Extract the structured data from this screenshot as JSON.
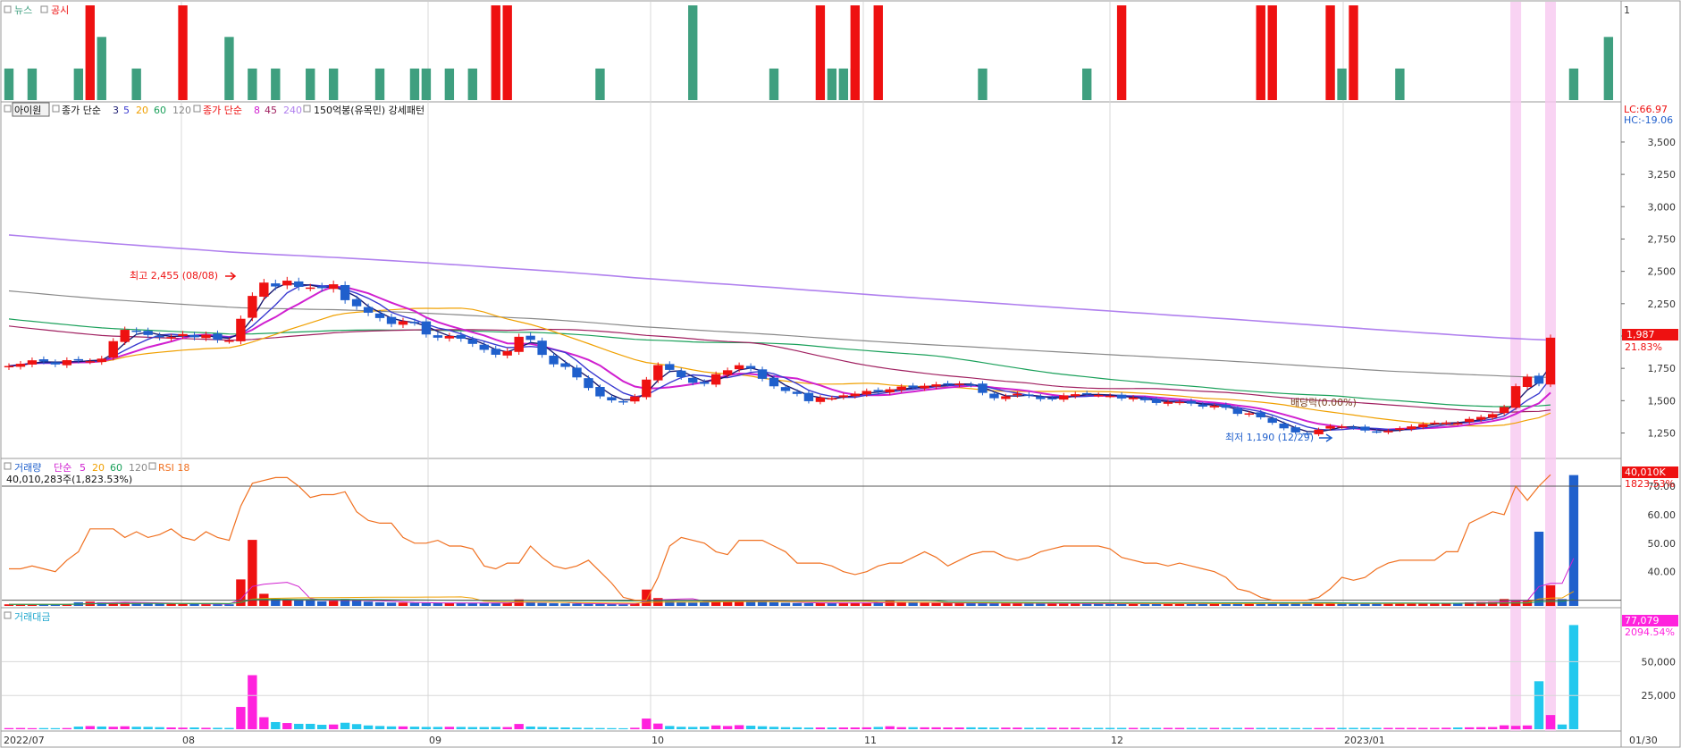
{
  "colors": {
    "up": "#ee1111",
    "down": "#1f5fcc",
    "news": "#3f9f7f",
    "disclosure": "#ee1111",
    "ma3": "#1a1a70",
    "ma5": "#3a3ad0",
    "ma20": "#f0a000",
    "ma60": "#1aa05a",
    "ma120": "#888888",
    "ma8": "#d020d0",
    "ma45": "#a02060",
    "ma240": "#b080ee",
    "rsi": "#f07020",
    "volume_up": "#ee1111",
    "volume_down": "#2060cc",
    "amount_up": "#ff22dd",
    "amount_down": "#22c8ee",
    "highlight": "#f8c8f0",
    "grid": "#d8d8d8"
  },
  "panels": {
    "news": {
      "news_label": "뉴스",
      "disclosure_label": "공시",
      "axis_value": "1"
    },
    "price": {
      "stock_name": "아이원",
      "ma_group_1": {
        "label": "종가 단순",
        "periods": [
          "3",
          "5",
          "20",
          "60",
          "120"
        ]
      },
      "ma_group_2": {
        "label": "종가 단순",
        "periods": [
          "8",
          "45",
          "240"
        ]
      },
      "pattern_label": "150억봉(유목민) 강세패턴",
      "lc": "LC:66.97",
      "hc": "HC:-19.06",
      "last_price": "1,987",
      "last_change": "21.83%",
      "high_label": "최고 2,455 (08/08)",
      "low_label": "최저 1,190 (12/29)",
      "dividend_label": "배당락(0.00%)"
    },
    "volume": {
      "title": "거래량",
      "ma_label": "단순",
      "ma_periods": [
        "5",
        "20",
        "60",
        "120"
      ],
      "rsi_label": "RSI 18",
      "info": "40,010,283주(1,823.53%)",
      "last_value": "40,010K",
      "last_pct": "1823.53%"
    },
    "amount": {
      "title": "거래대금",
      "last_value": "77,079",
      "last_pct": "2094.54%"
    }
  },
  "x_axis_labels": [
    "2022/07",
    "08",
    "09",
    "10",
    "11",
    "12",
    "2023/01",
    "01/30"
  ],
  "chart_data": [
    {
      "type": "bar",
      "title": "뉴스 / 공시",
      "series": [
        {
          "name": "뉴스",
          "bars": [
            [
              0,
              1
            ],
            [
              2,
              1
            ],
            [
              6,
              1
            ],
            [
              8,
              2
            ],
            [
              11,
              1
            ],
            [
              19,
              2
            ],
            [
              21,
              1
            ],
            [
              23,
              1
            ],
            [
              26,
              1
            ],
            [
              28,
              1
            ],
            [
              32,
              1
            ],
            [
              35,
              1
            ],
            [
              36,
              1
            ],
            [
              38,
              1
            ],
            [
              40,
              1
            ],
            [
              51,
              1
            ],
            [
              59,
              3
            ],
            [
              66,
              1
            ],
            [
              71,
              1
            ],
            [
              72,
              1
            ],
            [
              73,
              1
            ],
            [
              84,
              1
            ],
            [
              93,
              1
            ],
            [
              115,
              1
            ],
            [
              120,
              1
            ],
            [
              135,
              1
            ],
            [
              138,
              2
            ]
          ]
        },
        {
          "name": "공시",
          "bars": [
            [
              7,
              3
            ],
            [
              15,
              3
            ],
            [
              42,
              3
            ],
            [
              43,
              3
            ],
            [
              70,
              3
            ],
            [
              73,
              3
            ],
            [
              75,
              3
            ],
            [
              96,
              3
            ],
            [
              108,
              3
            ],
            [
              109,
              3
            ],
            [
              114,
              3
            ],
            [
              116,
              3
            ]
          ]
        }
      ],
      "ylim": [
        0,
        3
      ]
    },
    {
      "type": "candlestick",
      "title": "아이원",
      "ylim": [
        1060,
        3700
      ],
      "y_ticks": [
        1250,
        1500,
        1750,
        2000,
        2250,
        2500,
        2750,
        3000,
        3250,
        3500
      ],
      "y_tick_labels": [
        "1,250",
        "1,500",
        "1,750",
        "2,000",
        "2,250",
        "2,500",
        "2,750",
        "3,000",
        "3,250",
        "3,500"
      ],
      "close": [
        1768,
        1785,
        1812,
        1803,
        1780,
        1813,
        1810,
        1805,
        1825,
        1960,
        2048,
        2032,
        2008,
        1990,
        1992,
        2015,
        1990,
        2010,
        1970,
        1965,
        2133,
        2310,
        2413,
        2383,
        2428,
        2380,
        2375,
        2370,
        2400,
        2277,
        2230,
        2180,
        2139,
        2093,
        2115,
        2105,
        2012,
        1987,
        2000,
        1979,
        1939,
        1893,
        1855,
        1883,
        1994,
        1970,
        1854,
        1781,
        1761,
        1680,
        1598,
        1533,
        1502,
        1486,
        1533,
        1663,
        1775,
        1738,
        1682,
        1638,
        1630,
        1705,
        1735,
        1774,
        1748,
        1669,
        1611,
        1575,
        1552,
        1496,
        1524,
        1519,
        1541,
        1554,
        1575,
        1570,
        1588,
        1609,
        1601,
        1615,
        1626,
        1630,
        1631,
        1624,
        1560,
        1519,
        1534,
        1554,
        1539,
        1512,
        1514,
        1541,
        1550,
        1550,
        1544,
        1538,
        1517,
        1524,
        1503,
        1482,
        1490,
        1491,
        1477,
        1454,
        1460,
        1445,
        1398,
        1402,
        1371,
        1329,
        1286,
        1254,
        1246,
        1276,
        1304,
        1302,
        1291,
        1269,
        1261,
        1266,
        1286,
        1301,
        1319,
        1330,
        1331,
        1327,
        1359,
        1374,
        1396,
        1451,
        1612,
        1685,
        1631,
        1987
      ]
    },
    {
      "type": "line",
      "title": "RSI 18",
      "y_ticks": [
        40,
        50,
        60,
        70
      ],
      "y_tick_labels": [
        "40.00",
        "50.00",
        "60.00",
        "70.00"
      ],
      "ylim": [
        28,
        75
      ],
      "values": [
        41,
        41,
        42,
        41,
        40,
        44,
        47,
        55,
        55,
        55,
        52,
        54,
        52,
        53,
        55,
        52,
        51,
        54,
        52,
        51,
        63,
        71,
        72,
        73,
        73,
        70,
        66,
        67,
        67,
        68,
        61,
        58,
        57,
        57,
        52,
        50,
        50,
        51,
        49,
        49,
        48,
        42,
        41,
        43,
        43,
        49,
        45,
        42,
        41,
        42,
        44,
        40,
        36,
        31,
        30,
        30,
        38,
        49,
        52,
        51,
        50,
        47,
        46,
        51,
        51,
        51,
        49,
        47,
        43,
        43,
        43,
        42,
        40,
        39,
        40,
        42,
        43,
        43,
        45,
        47,
        45,
        42,
        44,
        46,
        47,
        47,
        45,
        44,
        45,
        47,
        48,
        49,
        49,
        49,
        49,
        48,
        45,
        44,
        43,
        43,
        42,
        43,
        42,
        41,
        40,
        38,
        34,
        33,
        31,
        30,
        30,
        30,
        30,
        31,
        34,
        38,
        37,
        38,
        41,
        43,
        44,
        44,
        44,
        44,
        47,
        47,
        57,
        59,
        61,
        60,
        70,
        65,
        70,
        74
      ]
    },
    {
      "type": "bar",
      "title": "거래량",
      "y_ticks": [],
      "values_k": [
        480,
        520,
        430,
        470,
        440,
        480,
        1100,
        1300,
        1100,
        950,
        1100,
        900,
        870,
        760,
        660,
        590,
        660,
        530,
        530,
        490,
        8100,
        20200,
        3700,
        2200,
        1900,
        1700,
        1700,
        1400,
        1500,
        2100,
        1700,
        1300,
        1100,
        1000,
        1000,
        910,
        870,
        870,
        920,
        860,
        810,
        880,
        900,
        880,
        2000,
        1000,
        890,
        800,
        750,
        690,
        630,
        570,
        530,
        480,
        750,
        5000,
        2400,
        1400,
        1100,
        1000,
        1200,
        1700,
        1400,
        1700,
        1500,
        1300,
        1100,
        940,
        870,
        820,
        900,
        880,
        870,
        870,
        950,
        1100,
        1500,
        1000,
        960,
        920,
        870,
        840,
        820,
        870,
        870,
        830,
        800,
        780,
        760,
        750,
        740,
        720,
        700,
        690,
        680,
        670,
        680,
        700,
        690,
        680,
        700,
        700,
        700,
        710,
        720,
        770,
        780,
        800,
        810,
        850,
        820,
        1000,
        780,
        740,
        700,
        740,
        790,
        770,
        790,
        790,
        790,
        760,
        780,
        800,
        850,
        960,
        1100,
        1200,
        1300,
        2100,
        1600,
        1800,
        22700,
        6300,
        2100,
        40010
      ],
      "up_flags": [
        1,
        1,
        1,
        0,
        0,
        1,
        0,
        1,
        0,
        1,
        1,
        0,
        0,
        0,
        1,
        1,
        0,
        1,
        0,
        0,
        1,
        1,
        1,
        0,
        1,
        0,
        0,
        0,
        1,
        0,
        0,
        0,
        0,
        0,
        1,
        0,
        0,
        0,
        1,
        0,
        0,
        0,
        0,
        1,
        1,
        0,
        0,
        0,
        0,
        0,
        0,
        0,
        0,
        0,
        1,
        1,
        1,
        0,
        0,
        0,
        0,
        1,
        1,
        1,
        0,
        0,
        0,
        0,
        0,
        0,
        1,
        0,
        1,
        1,
        1,
        0,
        1,
        1,
        0,
        1,
        1,
        1,
        1,
        0,
        0,
        0,
        1,
        1,
        0,
        0,
        1,
        1,
        1,
        0,
        0,
        0,
        0,
        1,
        0,
        0,
        1,
        1,
        0,
        0,
        1,
        0,
        0,
        1,
        0,
        0,
        0,
        0,
        0,
        1,
        1,
        0,
        0,
        0,
        0,
        1,
        1,
        1,
        1,
        1,
        1,
        0,
        1,
        1,
        1,
        1,
        1,
        1,
        0,
        1
      ]
    },
    {
      "type": "bar",
      "title": "거래대금",
      "y_ticks": [
        25000,
        50000
      ],
      "y_tick_labels": [
        "25,000",
        "50,000"
      ],
      "ylim": [
        0,
        80000
      ],
      "values": [
        846,
        929,
        778,
        846,
        789,
        874,
        1960,
        2349,
        2008,
        1840,
        2187,
        1826,
        1742,
        1516,
        1319,
        1184,
        1317,
        1064,
        1050,
        965,
        16500,
        40000,
        8900,
        5300,
        4600,
        4000,
        4000,
        3300,
        3500,
        4800,
        3800,
        2800,
        2400,
        2100,
        2100,
        1900,
        1700,
        1700,
        1800,
        1700,
        1600,
        1600,
        1700,
        1600,
        3900,
        2000,
        1700,
        1400,
        1300,
        1100,
        1000,
        880,
        800,
        720,
        1100,
        7900,
        4200,
        2400,
        1800,
        1700,
        1900,
        2800,
        2400,
        3000,
        2600,
        2200,
        1800,
        1500,
        1400,
        1200,
        1300,
        1300,
        1300,
        1300,
        1400,
        1700,
        2200,
        1500,
        1500,
        1400,
        1400,
        1300,
        1300,
        1400,
        1300,
        1200,
        1200,
        1200,
        1100,
        1100,
        1100,
        1100,
        1100,
        1000,
        1000,
        1000,
        1000,
        1000,
        1000,
        1000,
        1000,
        1000,
        1000,
        1000,
        1000,
        1000,
        1000,
        1000,
        1000,
        1000,
        1000,
        900,
        900,
        900,
        1000,
        1000,
        1000,
        1000,
        1000,
        1000,
        1000,
        1000,
        1000,
        1000,
        1100,
        1300,
        1400,
        1500,
        1600,
        2900,
        2500,
        2800,
        35500,
        10500,
        3500,
        77079
      ]
    }
  ]
}
